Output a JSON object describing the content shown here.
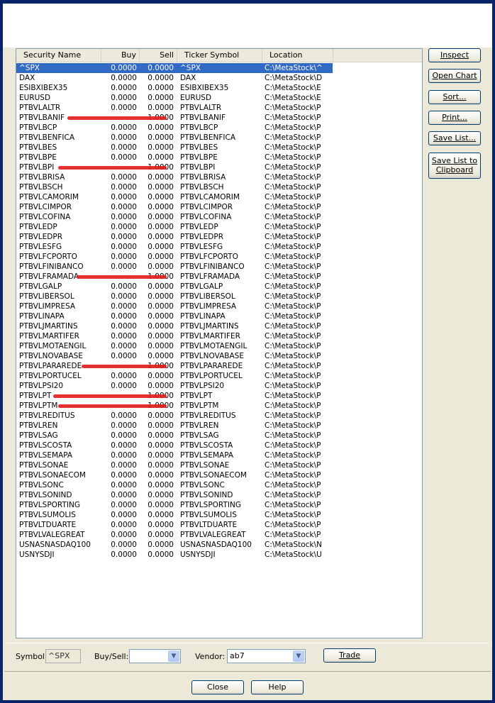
{
  "columns": {
    "name": "Security Name",
    "buy": "Buy",
    "sell": "Sell",
    "ticker": "Ticker Symbol",
    "location": "Location"
  },
  "rows": [
    {
      "name": "^SPX",
      "buy": "0.0000",
      "sell": "0.0000",
      "ticker": "^SPX",
      "loc": "C:\\MetaStock\\^",
      "selected": true
    },
    {
      "name": "DAX",
      "buy": "0.0000",
      "sell": "0.0000",
      "ticker": "DAX",
      "loc": "C:\\MetaStock\\D"
    },
    {
      "name": "ESIBXIBEX35",
      "buy": "0.0000",
      "sell": "0.0000",
      "ticker": "ESIBXIBEX35",
      "loc": "C:\\MetaStock\\E"
    },
    {
      "name": "EURUSD",
      "buy": "0.0000",
      "sell": "0.0000",
      "ticker": "EURUSD",
      "loc": "C:\\MetaStock\\E"
    },
    {
      "name": "PTBVLALTR",
      "buy": "0.0000",
      "sell": "0.0000",
      "ticker": "PTBVLALTR",
      "loc": "C:\\MetaStock\\P"
    },
    {
      "name": "PTBVLBANIF",
      "buy": "",
      "sell": "1.0000",
      "ticker": "PTBVLBANIF",
      "loc": "C:\\MetaStock\\P",
      "scribble": true
    },
    {
      "name": "PTBVLBCP",
      "buy": "0.0000",
      "sell": "0.0000",
      "ticker": "PTBVLBCP",
      "loc": "C:\\MetaStock\\P"
    },
    {
      "name": "PTBVLBENFICA",
      "buy": "0.0000",
      "sell": "0.0000",
      "ticker": "PTBVLBENFICA",
      "loc": "C:\\MetaStock\\P"
    },
    {
      "name": "PTBVLBES",
      "buy": "0.0000",
      "sell": "0.0000",
      "ticker": "PTBVLBES",
      "loc": "C:\\MetaStock\\P"
    },
    {
      "name": "PTBVLBPE",
      "buy": "0.0000",
      "sell": "0.0000",
      "ticker": "PTBVLBPE",
      "loc": "C:\\MetaStock\\P"
    },
    {
      "name": "PTBVLBPI",
      "buy": "",
      "sell": "1.0000",
      "ticker": "PTBVLBPI",
      "loc": "C:\\MetaStock\\P",
      "scribble": true
    },
    {
      "name": "PTBVLBRISA",
      "buy": "0.0000",
      "sell": "0.0000",
      "ticker": "PTBVLBRISA",
      "loc": "C:\\MetaStock\\P"
    },
    {
      "name": "PTBVLBSCH",
      "buy": "0.0000",
      "sell": "0.0000",
      "ticker": "PTBVLBSCH",
      "loc": "C:\\MetaStock\\P"
    },
    {
      "name": "PTBVLCAMORIM",
      "buy": "0.0000",
      "sell": "0.0000",
      "ticker": "PTBVLCAMORIM",
      "loc": "C:\\MetaStock\\P"
    },
    {
      "name": "PTBVLCIMPOR",
      "buy": "0.0000",
      "sell": "0.0000",
      "ticker": "PTBVLCIMPOR",
      "loc": "C:\\MetaStock\\P"
    },
    {
      "name": "PTBVLCOFINA",
      "buy": "0.0000",
      "sell": "0.0000",
      "ticker": "PTBVLCOFINA",
      "loc": "C:\\MetaStock\\P"
    },
    {
      "name": "PTBVLEDP",
      "buy": "0.0000",
      "sell": "0.0000",
      "ticker": "PTBVLEDP",
      "loc": "C:\\MetaStock\\P"
    },
    {
      "name": "PTBVLEDPR",
      "buy": "0.0000",
      "sell": "0.0000",
      "ticker": "PTBVLEDPR",
      "loc": "C:\\MetaStock\\P"
    },
    {
      "name": "PTBVLESFG",
      "buy": "0.0000",
      "sell": "0.0000",
      "ticker": "PTBVLESFG",
      "loc": "C:\\MetaStock\\P"
    },
    {
      "name": "PTBVLFCPORTO",
      "buy": "0.0000",
      "sell": "0.0000",
      "ticker": "PTBVLFCPORTO",
      "loc": "C:\\MetaStock\\P"
    },
    {
      "name": "PTBVLFINIBANCO",
      "buy": "0.0000",
      "sell": "0.0000",
      "ticker": "PTBVLFINIBANCO",
      "loc": "C:\\MetaStock\\P"
    },
    {
      "name": "PTBVLFRAMADA",
      "buy": "",
      "sell": "1.0000",
      "ticker": "PTBVLFRAMADA",
      "loc": "C:\\MetaStock\\P",
      "scribble": true
    },
    {
      "name": "PTBVLGALP",
      "buy": "0.0000",
      "sell": "0.0000",
      "ticker": "PTBVLGALP",
      "loc": "C:\\MetaStock\\P"
    },
    {
      "name": "PTBVLIBERSOL",
      "buy": "0.0000",
      "sell": "0.0000",
      "ticker": "PTBVLIBERSOL",
      "loc": "C:\\MetaStock\\P"
    },
    {
      "name": "PTBVLIMPRESA",
      "buy": "0.0000",
      "sell": "0.0000",
      "ticker": "PTBVLIMPRESA",
      "loc": "C:\\MetaStock\\P"
    },
    {
      "name": "PTBVLINAPA",
      "buy": "0.0000",
      "sell": "0.0000",
      "ticker": "PTBVLINAPA",
      "loc": "C:\\MetaStock\\P"
    },
    {
      "name": "PTBVLJMARTINS",
      "buy": "0.0000",
      "sell": "0.0000",
      "ticker": "PTBVLJMARTINS",
      "loc": "C:\\MetaStock\\P"
    },
    {
      "name": "PTBVLMARTIFER",
      "buy": "0.0000",
      "sell": "0.0000",
      "ticker": "PTBVLMARTIFER",
      "loc": "C:\\MetaStock\\P"
    },
    {
      "name": "PTBVLMOTAENGIL",
      "buy": "0.0000",
      "sell": "0.0000",
      "ticker": "PTBVLMOTAENGIL",
      "loc": "C:\\MetaStock\\P"
    },
    {
      "name": "PTBVLNOVABASE",
      "buy": "0.0000",
      "sell": "0.0000",
      "ticker": "PTBVLNOVABASE",
      "loc": "C:\\MetaStock\\P"
    },
    {
      "name": "PTBVLPARAREDE",
      "buy": "",
      "sell": "1.0000",
      "ticker": "PTBVLPARAREDE",
      "loc": "C:\\MetaStock\\P",
      "scribble": true
    },
    {
      "name": "PTBVLPORTUCEL",
      "buy": "0.0000",
      "sell": "0.0000",
      "ticker": "PTBVLPORTUCEL",
      "loc": "C:\\MetaStock\\P"
    },
    {
      "name": "PTBVLPSI20",
      "buy": "0.0000",
      "sell": "0.0000",
      "ticker": "PTBVLPSI20",
      "loc": "C:\\MetaStock\\P"
    },
    {
      "name": "PTBVLPT",
      "buy": "",
      "sell": "1.0000",
      "ticker": "PTBVLPT",
      "loc": "C:\\MetaStock\\P",
      "scribble": true
    },
    {
      "name": "PTBVLPTM",
      "buy": "",
      "sell": "1.0000",
      "ticker": "PTBVLPTM",
      "loc": "C:\\MetaStock\\P",
      "scribble": true
    },
    {
      "name": "PTBVLREDITUS",
      "buy": "0.0000",
      "sell": "0.0000",
      "ticker": "PTBVLREDITUS",
      "loc": "C:\\MetaStock\\P"
    },
    {
      "name": "PTBVLREN",
      "buy": "0.0000",
      "sell": "0.0000",
      "ticker": "PTBVLREN",
      "loc": "C:\\MetaStock\\P"
    },
    {
      "name": "PTBVLSAG",
      "buy": "0.0000",
      "sell": "0.0000",
      "ticker": "PTBVLSAG",
      "loc": "C:\\MetaStock\\P"
    },
    {
      "name": "PTBVLSCOSTA",
      "buy": "0.0000",
      "sell": "0.0000",
      "ticker": "PTBVLSCOSTA",
      "loc": "C:\\MetaStock\\P"
    },
    {
      "name": "PTBVLSEMAPA",
      "buy": "0.0000",
      "sell": "0.0000",
      "ticker": "PTBVLSEMAPA",
      "loc": "C:\\MetaStock\\P"
    },
    {
      "name": "PTBVLSONAE",
      "buy": "0.0000",
      "sell": "0.0000",
      "ticker": "PTBVLSONAE",
      "loc": "C:\\MetaStock\\P"
    },
    {
      "name": "PTBVLSONAECOM",
      "buy": "0.0000",
      "sell": "0.0000",
      "ticker": "PTBVLSONAECOM",
      "loc": "C:\\MetaStock\\P"
    },
    {
      "name": "PTBVLSONC",
      "buy": "0.0000",
      "sell": "0.0000",
      "ticker": "PTBVLSONC",
      "loc": "C:\\MetaStock\\P"
    },
    {
      "name": "PTBVLSONIND",
      "buy": "0.0000",
      "sell": "0.0000",
      "ticker": "PTBVLSONIND",
      "loc": "C:\\MetaStock\\P"
    },
    {
      "name": "PTBVLSPORTING",
      "buy": "0.0000",
      "sell": "0.0000",
      "ticker": "PTBVLSPORTING",
      "loc": "C:\\MetaStock\\P"
    },
    {
      "name": "PTBVLSUMOLIS",
      "buy": "0.0000",
      "sell": "0.0000",
      "ticker": "PTBVLSUMOLIS",
      "loc": "C:\\MetaStock\\P"
    },
    {
      "name": "PTBVLTDUARTE",
      "buy": "0.0000",
      "sell": "0.0000",
      "ticker": "PTBVLTDUARTE",
      "loc": "C:\\MetaStock\\P"
    },
    {
      "name": "PTBVLVALEGREAT",
      "buy": "0.0000",
      "sell": "0.0000",
      "ticker": "PTBVLVALEGREAT",
      "loc": "C:\\MetaStock\\P"
    },
    {
      "name": "USNASNASDAQ100",
      "buy": "0.0000",
      "sell": "0.0000",
      "ticker": "USNASNASDAQ100",
      "loc": "C:\\MetaStock\\N"
    },
    {
      "name": "USNYSDJI",
      "buy": "0.0000",
      "sell": "0.0000",
      "ticker": "USNYSDJI",
      "loc": "C:\\MetaStock\\U"
    }
  ],
  "side_buttons": {
    "inspect": "Inspect",
    "open_chart": "Open Chart",
    "sort": "Sort...",
    "print": "Print...",
    "save_list": "Save List...",
    "save_list_clipboard": "Save List to Clipboard"
  },
  "bottom": {
    "symbol_label": "Symbol:",
    "symbol_value": "^SPX",
    "buysell_label": "Buy/Sell:",
    "buysell_value": "",
    "vendor_label": "Vendor:",
    "vendor_value": "ab7",
    "trade_label": "Trade"
  },
  "footer": {
    "close_label": "Close",
    "help_label": "Help"
  },
  "colors": {
    "selection": "#316ac5",
    "titlebar": "#0a246a",
    "scribble": "#e21919"
  }
}
